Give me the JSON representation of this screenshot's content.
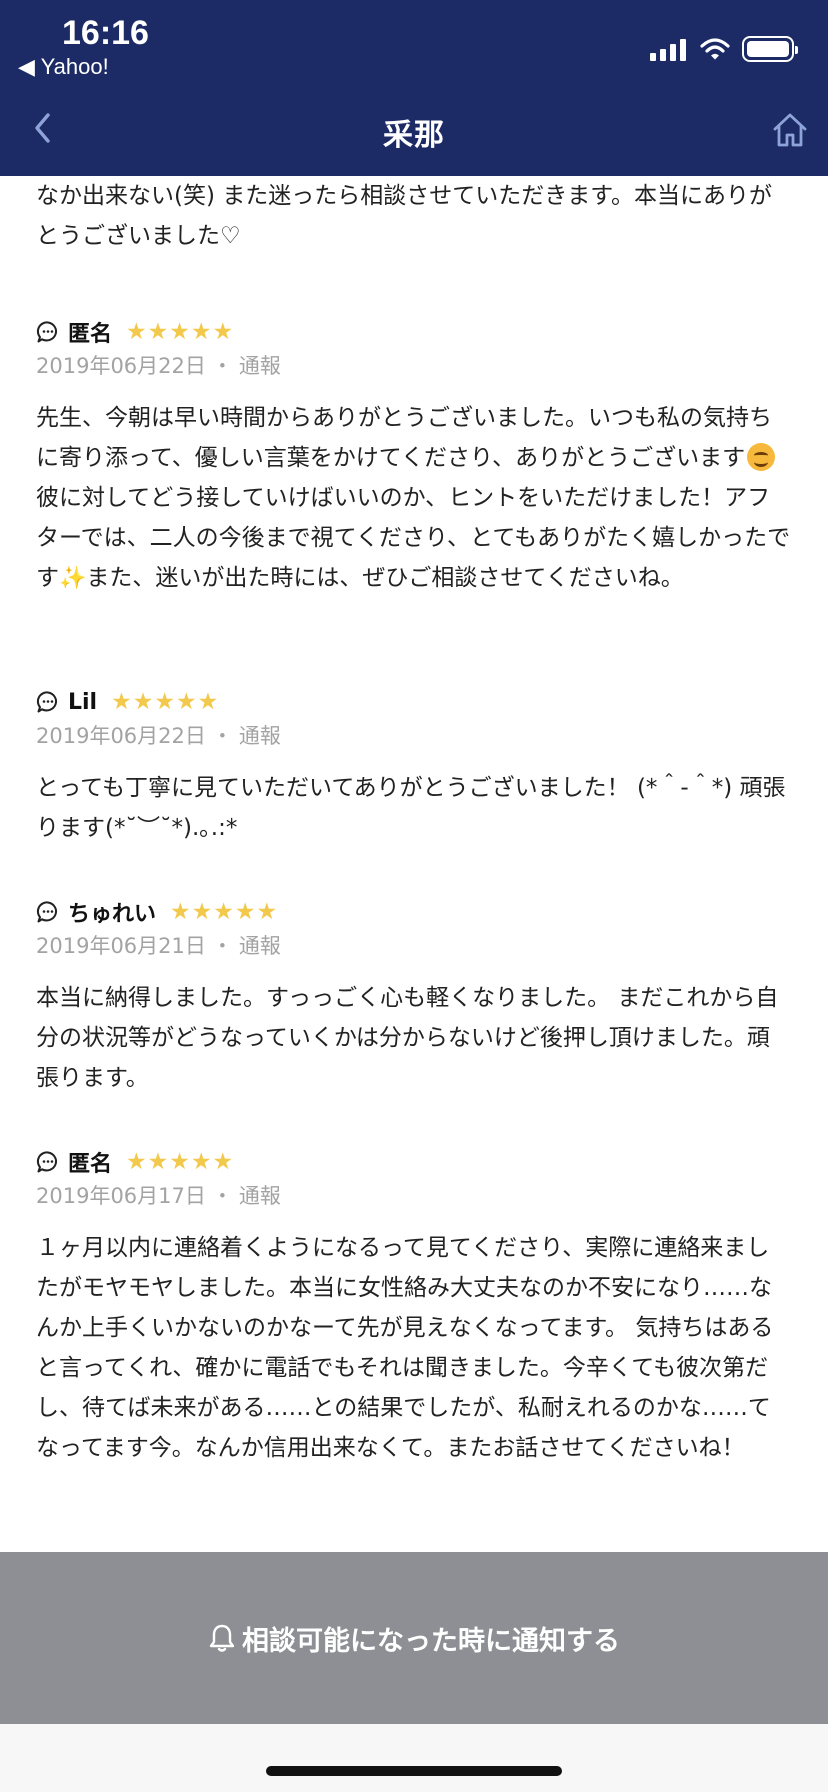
{
  "status_bar": {
    "time": "16:16",
    "back_app": "◀ Yahoo!"
  },
  "nav": {
    "title": "采那"
  },
  "continued_text": "なか出来ない(笑) また迷ったら相談させていただきます。本当にありがとうございました♡",
  "reviews": [
    {
      "name": "匿名",
      "stars": "★★★★★",
      "date": "2019年06月22日",
      "report": "通報",
      "text_a": "先生、今朝は早い時間からありがとうございました。いつも私の気持ちに寄り添って、優しい言葉をかけてくださり、ありがとうございます",
      "text_b": "彼に対してどう接していけばいいのか、ヒントをいただけました！アフターでは、二人の今後まで視てくださり、とてもありがたく嬉しかったです",
      "sparkle": "✨",
      "text_c": "また、迷いが出た時には、ぜひご相談させてくださいね。"
    },
    {
      "name": "Lil",
      "stars": "★★★★★",
      "date": "2019年06月22日",
      "report": "通報",
      "text": "とっても丁寧に見ていただいてありがとうございました！ (*＾-＾*) 頑張ります(*˘︶˘*).｡.:*"
    },
    {
      "name": "ちゅれい",
      "stars": "★★★★★",
      "date": "2019年06月21日",
      "report": "通報",
      "text": "本当に納得しました。すっっごく心も軽くなりました。 まだこれから自分の状況等がどうなっていくかは分からないけど後押し頂けました。頑張ります。"
    },
    {
      "name": "匿名",
      "stars": "★★★★★",
      "date": "2019年06月17日",
      "report": "通報",
      "text": "１ヶ月以内に連絡着くようになるって見てくださり、実際に連絡来ましたがモヤモヤしました。本当に女性絡み大丈夫なのか不安になり……なんか上手くいかないのかなーて先が見えなくなってます。 気持ちはあると言ってくれ、確かに電話でもそれは聞きました。今辛くても彼次第だし、待てば未来がある……との結果でしたが、私耐えれるのかな……てなってます今。なんか信用出来なくて。またお話させてくださいね！"
    }
  ],
  "notify_button": {
    "label": "相談可能になった時に通知する"
  },
  "colors": {
    "header": "#1c2a66",
    "stars": "#f2c94c",
    "notify_bar": "#8e8f94"
  },
  "icons": [
    "chevron-left-icon",
    "home-icon",
    "speech-bubble-icon",
    "bell-icon",
    "wifi-icon",
    "signal-icon",
    "battery-icon"
  ]
}
